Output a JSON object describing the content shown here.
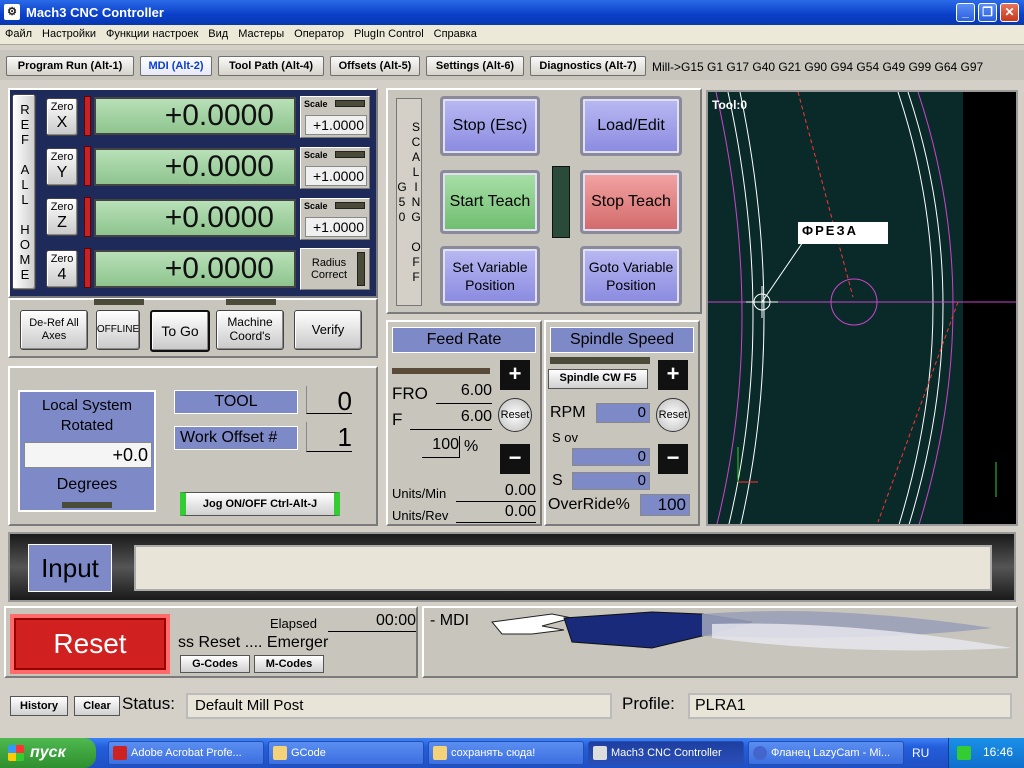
{
  "window": {
    "title": "Mach3 CNC Controller",
    "app_icon": "mach3-icon"
  },
  "menu": [
    "Файл",
    "Настройки",
    "Функции настроек",
    "Вид",
    "Мастеры",
    "Оператор",
    "PlugIn Control",
    "Справка"
  ],
  "tabs": [
    "Program Run (Alt-1)",
    "MDI (Alt-2)",
    "Tool Path (Alt-4)",
    "Offsets (Alt-5)",
    "Settings (Alt-6)",
    "Diagnostics (Alt-7)"
  ],
  "active_tab": "MDI (Alt-2)",
  "modal_line": "Mill->G15  G1 G17 G40 G21 G90 G94 G54 G49 G99 G64 G97",
  "ref_all_home": "REF ALL HOME",
  "axes": [
    {
      "zero": "Zero",
      "axis": "X",
      "value": "+0.0000",
      "scale_label": "Scale",
      "scale": "+1.0000"
    },
    {
      "zero": "Zero",
      "axis": "Y",
      "value": "+0.0000",
      "scale_label": "Scale",
      "scale": "+1.0000"
    },
    {
      "zero": "Zero",
      "axis": "Z",
      "value": "+0.0000",
      "scale_label": "Scale",
      "scale": "+1.0000"
    },
    {
      "zero": "Zero",
      "axis": "4",
      "value": "+0.0000",
      "radius": "Radius Correct"
    }
  ],
  "dro_buttons": {
    "deref": "De-Ref All Axes",
    "offline": "OFFLINE",
    "togo": "To Go",
    "machine": "Machine Coord's",
    "verify": "Verify"
  },
  "scaling": "SCALING OFF G50",
  "control_buttons": {
    "stop": "Stop (Esc)",
    "load_edit": "Load/Edit",
    "start_teach": "Start Teach",
    "stop_teach": "Stop Teach",
    "set_var": "Set Variable Position",
    "goto_var": "Goto Variable Position"
  },
  "toolpath": {
    "tool_label": "Tool:0",
    "annotation": "ФРЕЗА"
  },
  "local": {
    "title": "Local System Rotated",
    "value": "+0.0",
    "unit": "Degrees"
  },
  "tool": {
    "label": "TOOL",
    "value": "0",
    "offset_label": "Work Offset #",
    "offset_value": "1",
    "jog": "Jog ON/OFF Ctrl-Alt-J"
  },
  "feed": {
    "title": "Feed Rate",
    "fro_label": "FRO",
    "fro": "6.00",
    "f_label": "F",
    "f": "6.00",
    "pct": "100",
    "pct_sign": "%",
    "reset": "Reset",
    "units_min_label": "Units/Min",
    "units_min": "0.00",
    "units_rev_label": "Units/Rev",
    "units_rev": "0.00"
  },
  "spindle": {
    "title": "Spindle Speed",
    "cw": "Spindle CW F5",
    "rpm_label": "RPM",
    "rpm": "0",
    "sov_label": "S ov",
    "sov": "0",
    "s_label": "S",
    "s": "0",
    "reset": "Reset",
    "override_label": "OverRide%",
    "override": "100"
  },
  "input": {
    "label": "Input",
    "value": ""
  },
  "reset": {
    "label": "Reset",
    "elapsed_label": "Elapsed",
    "elapsed": "00:00",
    "scroll": "ss Reset .... Emerger",
    "gcodes": "G-Codes",
    "mcodes": "M-Codes",
    "mdi": "- MDI"
  },
  "status": {
    "history": "History",
    "clear": "Clear",
    "label": "Status:",
    "value": "Default Mill Post",
    "profile_label": "Profile:",
    "profile": "PLRA1"
  },
  "taskbar": {
    "start": "пуск",
    "items": [
      "Adobe Acrobat Profe...",
      "GCode",
      "сохранять сюда!",
      "Mach3 CNC Controller",
      "Фланец LazyCam - Mi..."
    ],
    "lang": "RU",
    "time": "16:46"
  }
}
